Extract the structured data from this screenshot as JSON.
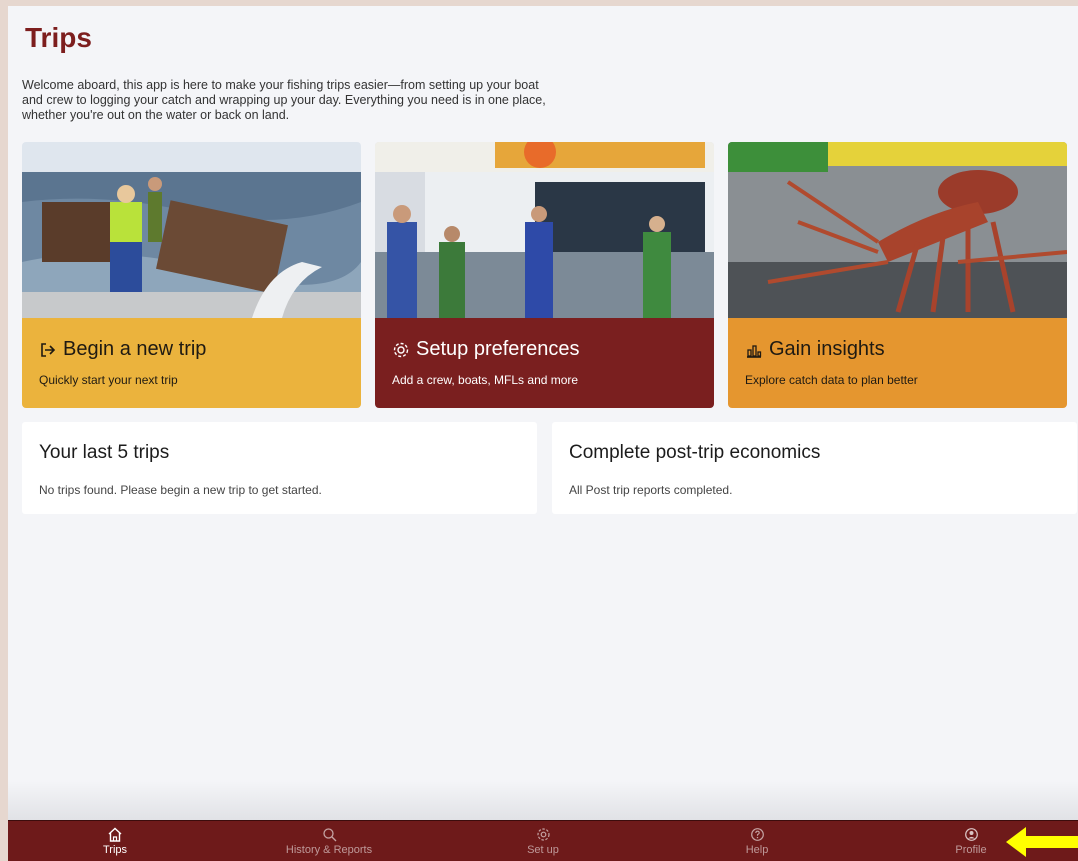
{
  "page": {
    "title": "Trips",
    "intro": "Welcome aboard, this app is here to make your fishing trips easier—from setting up your boat and crew to logging your catch and wrapping up your day. Everything you need is in one place, whether you're out on the water or back on land."
  },
  "cards": [
    {
      "icon": "sign-in-icon",
      "title": "Begin a new trip",
      "subtitle": "Quickly start your next trip",
      "color": "#ebb33d"
    },
    {
      "icon": "gear-icon",
      "title": "Setup preferences",
      "subtitle": "Add a crew, boats, MFLs and more",
      "color": "#7a1f1f"
    },
    {
      "icon": "bar-chart-icon",
      "title": "Gain insights",
      "subtitle": "Explore catch data to plan better",
      "color": "#e5962f"
    }
  ],
  "panels": {
    "last_trips": {
      "title": "Your last 5 trips",
      "message": "No trips found. Please begin a new trip to get started."
    },
    "economics": {
      "title": "Complete post-trip economics",
      "message": "All Post trip reports completed."
    }
  },
  "tabbar": {
    "items": [
      {
        "label": "Trips",
        "icon": "home-icon",
        "active": true
      },
      {
        "label": "History & Reports",
        "icon": "search-icon",
        "active": false
      },
      {
        "label": "Set up",
        "icon": "gear-icon",
        "active": false
      },
      {
        "label": "Help",
        "icon": "help-icon",
        "active": false
      },
      {
        "label": "Profile",
        "icon": "profile-icon",
        "active": false
      }
    ]
  },
  "colors": {
    "brand_maroon": "#7d1e1e",
    "tabbar": "#6e1a1a",
    "annotation_arrow": "#ffff00"
  }
}
